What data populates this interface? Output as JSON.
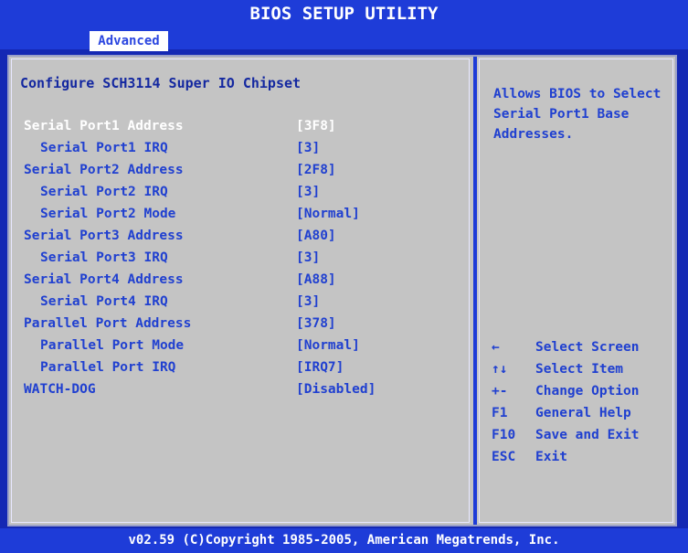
{
  "title": "BIOS SETUP UTILITY",
  "tabs": [
    {
      "label": "Advanced"
    }
  ],
  "section_title": "Configure SCH3114 Super IO Chipset",
  "settings": [
    {
      "label": "Serial Port1 Address",
      "value": "[3F8]",
      "indent": 0,
      "selected": true
    },
    {
      "label": "Serial Port1 IRQ",
      "value": "[3]",
      "indent": 1
    },
    {
      "label": "Serial Port2 Address",
      "value": "[2F8]",
      "indent": 0
    },
    {
      "label": "Serial Port2 IRQ",
      "value": "[3]",
      "indent": 1
    },
    {
      "label": "Serial Port2 Mode",
      "value": "[Normal]",
      "indent": 1
    },
    {
      "label": "Serial Port3 Address",
      "value": "[A80]",
      "indent": 0
    },
    {
      "label": "Serial Port3 IRQ",
      "value": "[3]",
      "indent": 1
    },
    {
      "label": "Serial Port4 Address",
      "value": "[A88]",
      "indent": 0
    },
    {
      "label": "Serial Port4 IRQ",
      "value": "[3]",
      "indent": 1
    },
    {
      "label": "Parallel Port Address",
      "value": "[378]",
      "indent": 0
    },
    {
      "label": "Parallel Port Mode",
      "value": "[Normal]",
      "indent": 1
    },
    {
      "label": "Parallel Port IRQ",
      "value": "[IRQ7]",
      "indent": 1
    },
    {
      "label": "WATCH-DOG",
      "value": "[Disabled]",
      "indent": 0
    }
  ],
  "help_text": "Allows BIOS to Select\nSerial Port1 Base\nAddresses.",
  "keys": [
    {
      "key": "←",
      "desc": "Select Screen"
    },
    {
      "key": "↑↓",
      "desc": "Select Item"
    },
    {
      "key": "+-",
      "desc": "Change Option"
    },
    {
      "key": "F1",
      "desc": "General Help"
    },
    {
      "key": "F10",
      "desc": "Save and Exit"
    },
    {
      "key": "ESC",
      "desc": "Exit"
    }
  ],
  "footer": "v02.59 (C)Copyright 1985-2005, American Megatrends, Inc.",
  "colors": {
    "background": "#1428b4",
    "panel": "#c4c4c4",
    "text": "#2040d0",
    "highlight": "#ffffff"
  }
}
